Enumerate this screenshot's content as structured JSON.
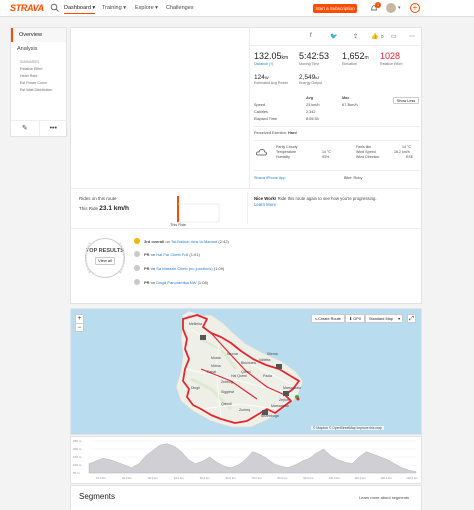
{
  "brand": {
    "name": "STRAVA",
    "accent": "#fc4c02",
    "link": "#1b7fd1"
  },
  "nav": {
    "items": [
      {
        "label": "Dashboard ▾"
      },
      {
        "label": "Training ▾"
      },
      {
        "label": "Explore ▾"
      },
      {
        "label": "Challenges"
      }
    ],
    "subscribe": "Start a Subscription",
    "notifications": "1"
  },
  "sidebar": {
    "tabs": [
      "Overview",
      "Analysis"
    ],
    "subheading": "SUMMARIES",
    "subitems": [
      "Relative Effort",
      "Heart Rate",
      "Est Power Curve",
      "Est Watt Distribution"
    ]
  },
  "social": {
    "kudos": "0"
  },
  "stats": {
    "primary": [
      {
        "value": "132.05",
        "unit": "km",
        "label": "Distance (?)"
      },
      {
        "value": "5:42:53",
        "unit": "",
        "label": "Moving Time"
      },
      {
        "value": "1,652",
        "unit": "m",
        "label": "Elevation"
      },
      {
        "value": "1028",
        "unit": "",
        "label": "Relative Effort"
      }
    ],
    "secondary": [
      {
        "value": "124",
        "unit": "W",
        "label": "Estimated Avg Power"
      },
      {
        "value": "2,549",
        "unit": "kJ",
        "label": "Energy Output"
      }
    ],
    "table": {
      "headers": [
        "Avg",
        "Max"
      ],
      "rows": [
        {
          "label": "Speed",
          "avg": "23 km/h",
          "max": "67.3km/h"
        },
        {
          "label": "Calories",
          "avg": "2,342",
          "max": ""
        },
        {
          "label": "Elapsed Time",
          "avg": "8:05:53",
          "max": ""
        }
      ]
    },
    "show_less": "Show Less",
    "perceived": "Perceived Exertion",
    "perceived_val": "Hard"
  },
  "weather": {
    "condition": "Partly Cloudy",
    "temp_label": "Temperature",
    "temp": "14 °C",
    "humidity_label": "Humidity",
    "humidity": "93%",
    "feels_label": "Feels like",
    "feels": "14 °C",
    "wind_speed_label": "Wind Speed",
    "wind_speed": "16.2 km/h",
    "wind_dir_label": "Wind Direction",
    "wind_dir": "ESE"
  },
  "device": "Strava iPhone App",
  "bike_label": "Bike",
  "bike": "Ruby",
  "rides": {
    "heading": "Rides on this route",
    "this_ride_label": "This Ride",
    "this_ride_speed": "23.1 km/h",
    "bar_label": "This Ride"
  },
  "nicework": {
    "bold": "Nice Work!",
    "text": " Ride this route again to see how you're progressing.",
    "link": "Learn More"
  },
  "top_results": {
    "title": "TOP RESULTS",
    "view_all": "View all"
  },
  "achievements": [
    {
      "prefix": "3rd overall",
      "mid": " on ",
      "link": "Tal-Balkun runs to Mamuri",
      "suffix": " (2:42)",
      "color": "#f2b705"
    },
    {
      "prefix": "PR",
      "mid": " on ",
      "link": "Hal Far Climb Full",
      "suffix": " (1:01)",
      "color": "#c9c9c9"
    },
    {
      "prefix": "PR",
      "mid": " on ",
      "link": "Sa Masson Climb (no junctions)",
      "suffix": " (1:09)",
      "color": "#c9c9c9"
    },
    {
      "prefix": "PR",
      "mid": " on ",
      "link": "Dingli Panoramika NW",
      "suffix": " (1:08)",
      "color": "#c9c9c9"
    }
  ],
  "map": {
    "zoom_in": "+",
    "zoom_out": "−",
    "create_route": "Create Route",
    "gpx": "GPX",
    "style": "Standard Map",
    "attribution": "© Mapbox © OpenStreetMap Improve this map",
    "places": [
      "Birkirkara",
      "Valletta",
      "Paola",
      "Qormi",
      "Hal Qormi",
      "Zebbug",
      "Siggiewi",
      "Zejtun",
      "Mosta",
      "Rabat",
      "Mdina",
      "Dingli",
      "Zurrieq",
      "Marsaskala",
      "Marsaxlokk",
      "Birzebbuga",
      "Mellieha",
      "Naxxar",
      "Sliema",
      "Qrendi"
    ]
  },
  "elevation": {
    "y_ticks": [
      "250 m",
      "200 m",
      "150 m",
      "100 m",
      "50 m"
    ],
    "x_ticks": [
      "10.0 km",
      "20.0 km",
      "30.0 km",
      "40.0 km",
      "50.0 km",
      "60.0 km",
      "70.0 km",
      "80.0 km",
      "90.0 km",
      "100.0 km",
      "110.0 km",
      "120.0 km",
      "130.0 km"
    ],
    "profile": [
      90,
      110,
      130,
      120,
      100,
      80,
      60,
      90,
      150,
      190,
      230,
      240,
      220,
      180,
      120,
      90,
      110,
      140,
      100,
      70,
      60,
      80,
      120,
      180,
      160,
      130,
      90,
      70,
      60,
      80,
      110,
      130,
      170,
      200,
      150,
      120,
      100,
      90,
      140,
      180,
      160,
      140,
      120,
      90,
      60,
      40,
      30
    ]
  },
  "segments": {
    "title": "Segments",
    "learn_more": "Learn more about segments"
  }
}
